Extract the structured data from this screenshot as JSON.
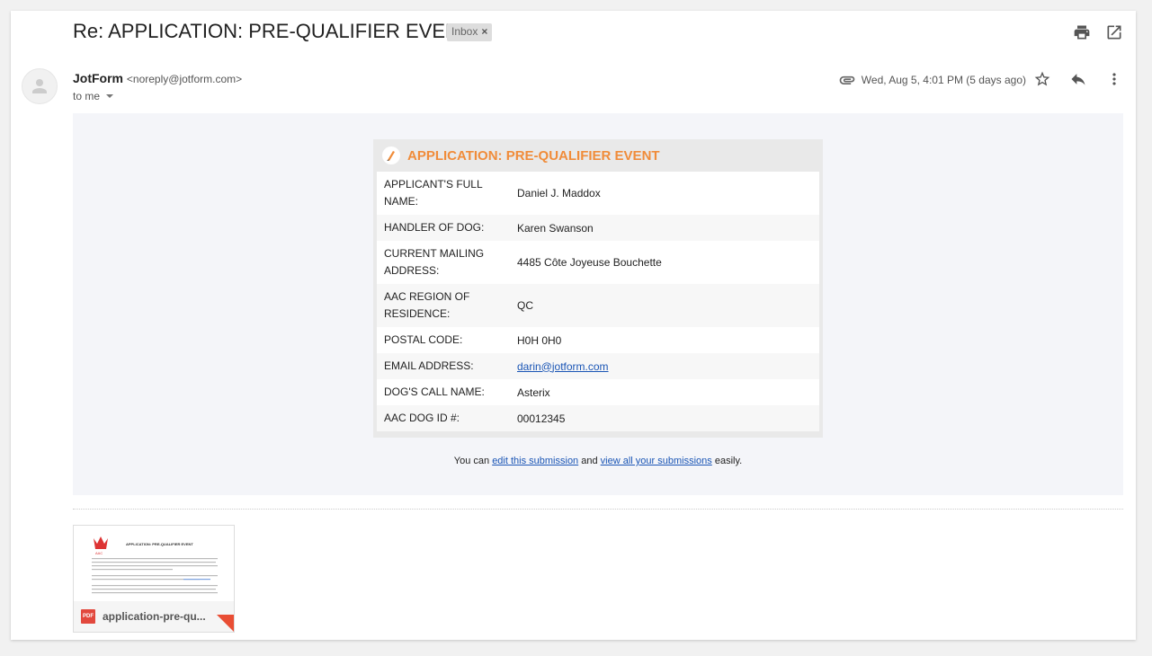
{
  "subject": "Re: APPLICATION: PRE-QUALIFIER EVENT",
  "label_chip": {
    "text": "Inbox",
    "close": "×"
  },
  "sender": {
    "name": "JotForm",
    "email": "<noreply@jotform.com>",
    "recipient": "to me",
    "timestamp": "Wed, Aug 5, 4:01 PM (5 days ago)"
  },
  "form": {
    "title": "APPLICATION: PRE-QUALIFIER EVENT",
    "rows": [
      {
        "label": "APPLICANT'S FULL NAME:",
        "value": "Daniel J. Maddox"
      },
      {
        "label": "HANDLER OF DOG:",
        "value": "Karen Swanson"
      },
      {
        "label": "CURRENT MAILING ADDRESS:",
        "value": "4485 Côte Joyeuse Bouchette"
      },
      {
        "label": "AAC REGION OF RESIDENCE:",
        "value": "QC"
      },
      {
        "label": "POSTAL CODE:",
        "value": "H0H 0H0"
      },
      {
        "label": "EMAIL ADDRESS:",
        "value": "darin@jotform.com"
      },
      {
        "label": "DOG'S CALL NAME:",
        "value": "Asterix"
      },
      {
        "label": "AAC DOG ID #:",
        "value": "00012345"
      }
    ]
  },
  "footer": {
    "prefix": "You can",
    "edit_link": "edit this submission",
    "middle": "and",
    "view_link": "view all your submissions",
    "suffix": "easily."
  },
  "attachment": {
    "filename": "application-pre-qu...",
    "type_badge": "PDF",
    "preview_title": "APPLICATION: PRE-QUALIFIER EVENT",
    "preview_logo": "AAC"
  },
  "icons": {
    "print": "print-icon",
    "open_new_window": "open-in-new-window-icon",
    "attachment": "paperclip-icon",
    "star": "star-icon",
    "reply": "reply-icon",
    "more": "more-vertical-icon",
    "avatar": "person-icon"
  },
  "colors": {
    "form_title": "#f08c3a",
    "link": "#1a55b5",
    "pdf_badge": "#e2483d",
    "panel_bg": "#f4f5f9"
  }
}
